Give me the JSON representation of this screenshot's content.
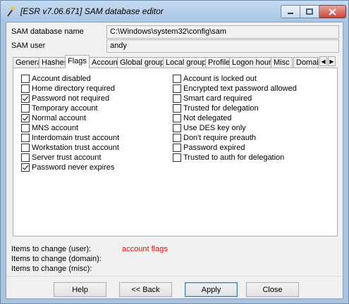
{
  "window": {
    "title": "[ESR v7.06.671]  SAM database editor"
  },
  "fields": {
    "sam_db_label": "SAM database name",
    "sam_db_value": "C:\\Windows\\system32\\config\\sam",
    "sam_user_label": "SAM user",
    "sam_user_value": "andy"
  },
  "tabs": [
    "General",
    "Hashes",
    "Flags",
    "Account",
    "Global groups",
    "Local groups",
    "Profile",
    "Logon hours",
    "Misc",
    "Domain"
  ],
  "active_tab": "Flags",
  "flags_left": [
    {
      "label": "Account disabled",
      "checked": false
    },
    {
      "label": "Home directory required",
      "checked": false
    },
    {
      "label": "Password not required",
      "checked": true
    },
    {
      "label": "Temporary account",
      "checked": false
    },
    {
      "label": "Normal account",
      "checked": true
    },
    {
      "label": "MNS account",
      "checked": false
    },
    {
      "label": "Interdomain trust account",
      "checked": false
    },
    {
      "label": "Workstation trust account",
      "checked": false
    },
    {
      "label": "Server trust account",
      "checked": false
    },
    {
      "label": "Password never expires",
      "checked": true
    }
  ],
  "flags_right": [
    {
      "label": "Account is locked out",
      "checked": false
    },
    {
      "label": "Encrypted text password allowed",
      "checked": false
    },
    {
      "label": "Smart card required",
      "checked": false
    },
    {
      "label": "Trusted for delegation",
      "checked": false
    },
    {
      "label": "Not delegated",
      "checked": false
    },
    {
      "label": "Use DES key only",
      "checked": false
    },
    {
      "label": "Don't require preauth",
      "checked": false
    },
    {
      "label": "Password expired",
      "checked": false
    },
    {
      "label": "Trusted to auth for delegation",
      "checked": false
    }
  ],
  "items_to_change": {
    "user_label": "Items to change (user):",
    "user_value": "account flags",
    "domain_label": "Items to change (domain):",
    "misc_label": "Items to change (misc):"
  },
  "buttons": {
    "help": "Help",
    "back": "<< Back",
    "apply": "Apply",
    "close": "Close"
  },
  "colors": {
    "titlebar": "#a9c5e4",
    "close_button": "#c8473a",
    "highlight_text": "#ff0000"
  },
  "icons": {
    "app": "wand-icon",
    "minimize": "minimize-icon",
    "maximize": "maximize-icon",
    "close": "close-icon",
    "tab_left": "arrow-left-icon",
    "tab_right": "arrow-right-icon"
  }
}
